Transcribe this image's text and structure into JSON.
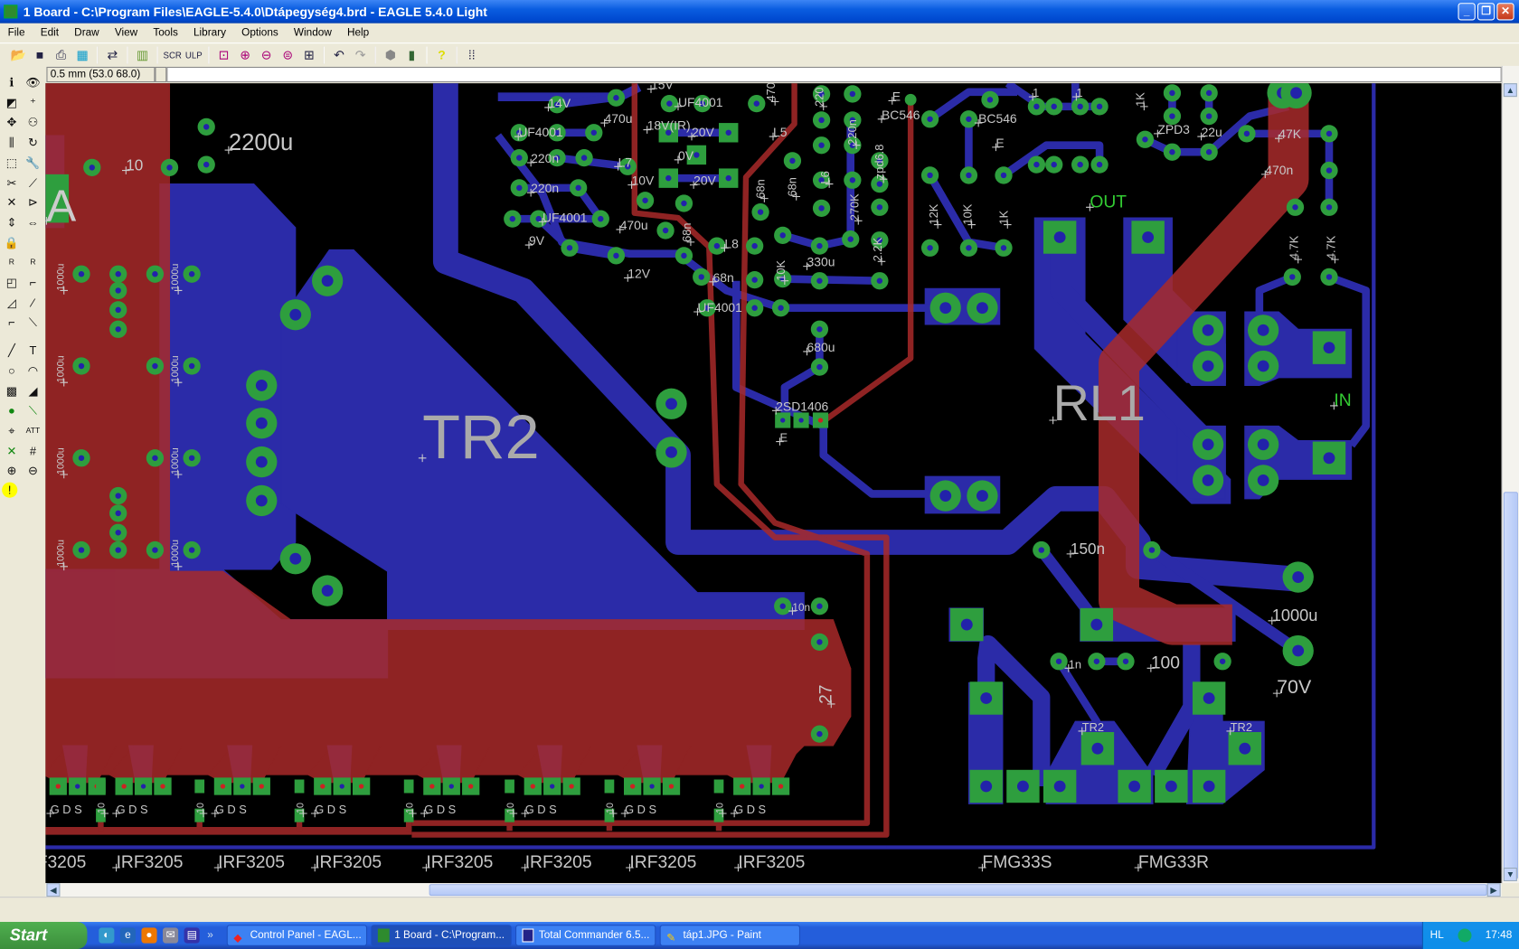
{
  "window": {
    "title": "1 Board - C:\\Program Files\\EAGLE-5.4.0\\Dtápegység4.brd - EAGLE 5.4.0 Light",
    "minimize": "_",
    "restore": "❐",
    "close": "✕"
  },
  "menu": [
    "File",
    "Edit",
    "Draw",
    "View",
    "Tools",
    "Library",
    "Options",
    "Window",
    "Help"
  ],
  "toolbar": [
    "open-icon",
    "save-icon",
    "print-icon",
    "cam-icon",
    "schematic-board-icon",
    "library-icon",
    "script-icon",
    "ulp-icon",
    "zoom-fit-icon",
    "zoom-in-icon",
    "zoom-out-icon",
    "zoom-redraw-icon",
    "zoom-select-icon",
    "undo-icon",
    "redo-icon",
    "stop-icon",
    "go-icon",
    "help-icon",
    "grid-icon"
  ],
  "command": {
    "coordinate": "0.5 mm (53.0 68.0)",
    "input": ""
  },
  "board": {
    "labels": [
      "2200u",
      "10",
      "TR2",
      "RL1",
      "OUT",
      "IN",
      "150n",
      "1000u",
      "100",
      "70V",
      "1n",
      "10n",
      "27",
      "2SD1406",
      "680u",
      "UF4001",
      "68n",
      "12V",
      "L8",
      "470u",
      "9V",
      "UF4001",
      "220n",
      "220n",
      "UF4001",
      "14V",
      "470u",
      "18V(IR)",
      "20V",
      "0V",
      "10V",
      "20V",
      "L7",
      "L5",
      "UF4001",
      "BC546",
      "BC546",
      "E",
      "E",
      "ZPD3",
      "22u",
      "47K",
      "470n",
      "330u",
      "IRF3205",
      "FMG33S",
      "FMG33R",
      "TR2",
      "10K",
      "12K",
      "10K",
      "1K",
      "4.7K",
      "4.7K",
      "270K",
      "2.2K",
      "zpd6.8",
      "220n",
      "L6",
      "68n",
      "68n",
      "1000u",
      "1K",
      "1",
      "1",
      "A",
      "G D S",
      "10",
      "E",
      "15V",
      "470",
      "220"
    ],
    "colors": {
      "top": "#a82a2a",
      "bottom": "#2b2ba8",
      "pad": "#2e9e3e",
      "background": "#000000"
    }
  },
  "taskbar": {
    "start": "Start",
    "tasks": [
      "Control Panel - EAGL...",
      "1 Board - C:\\Program...",
      "Total Commander 6.5...",
      "táp1.JPG - Paint"
    ],
    "lang": "HL",
    "clock": "17:48"
  }
}
